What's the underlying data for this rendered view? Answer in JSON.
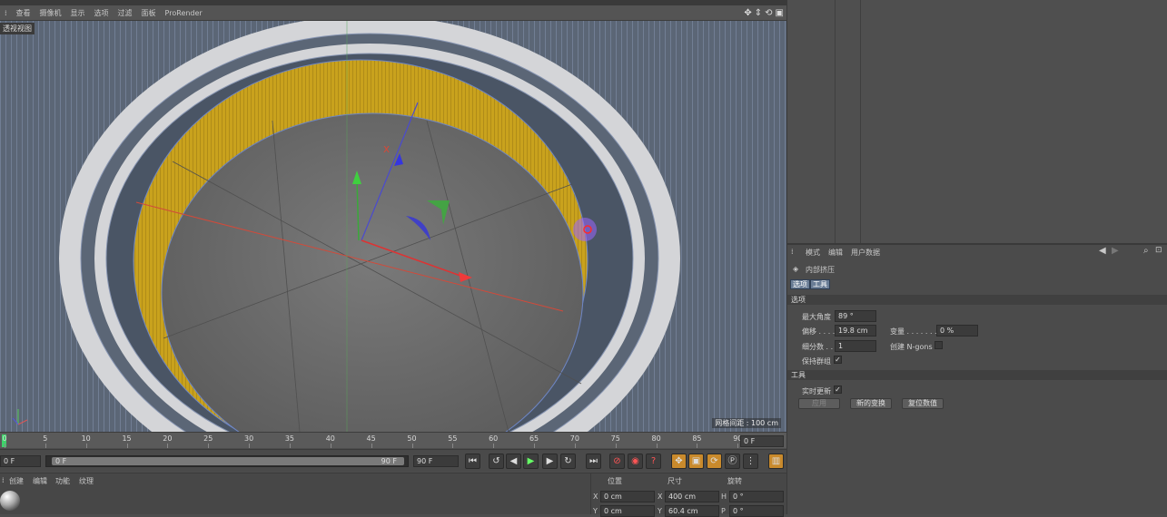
{
  "viewport": {
    "menu": [
      "查看",
      "摄像机",
      "显示",
      "选项",
      "过滤",
      "面板",
      "ProRender"
    ],
    "label": "透视视图",
    "grid_spacing": "网格间距 : 100 cm"
  },
  "timeline": {
    "ticks": [
      "0",
      "5",
      "10",
      "15",
      "20",
      "25",
      "30",
      "35",
      "40",
      "45",
      "50",
      "55",
      "60",
      "65",
      "70",
      "75",
      "80",
      "85",
      "90"
    ],
    "current_frame": "0 F"
  },
  "transport": {
    "start_frame": "0 F",
    "range_start": "0 F",
    "range_end": "90 F",
    "end_frame": "90 F"
  },
  "material_menu": [
    "创建",
    "编辑",
    "功能",
    "纹理"
  ],
  "coords": {
    "headers": [
      "位置",
      "尺寸",
      "旋转"
    ],
    "rows": [
      {
        "axis_pos": "X",
        "pos": "0 cm",
        "axis_size": "X",
        "size": "400 cm",
        "axis_rot": "H",
        "rot": "0 °"
      },
      {
        "axis_pos": "Y",
        "pos": "0 cm",
        "axis_size": "Y",
        "size": "60.4 cm",
        "axis_rot": "P",
        "rot": "0 °"
      }
    ]
  },
  "attributes": {
    "menu": [
      "模式",
      "编辑",
      "用户数据"
    ],
    "tool_name": "内部挤压",
    "tabs": [
      "选项",
      "工具"
    ],
    "section_options": "选项",
    "max_angle_label": "最大角度",
    "max_angle_value": "89 °",
    "offset_label": "偏移 . . . .",
    "offset_value": "19.8 cm",
    "variance_label": "变量 . . . . . . .",
    "variance_value": "0 %",
    "subdiv_label": "细分数 . .",
    "subdiv_value": "1",
    "create_ngons_label": "创建 N-gons",
    "keep_groups_label": "保持群组",
    "section_tool": "工具",
    "realtime_label": "实时更新",
    "apply_btn": "应用",
    "new_transform_btn": "新的变换",
    "reset_btn": "复位数值"
  }
}
